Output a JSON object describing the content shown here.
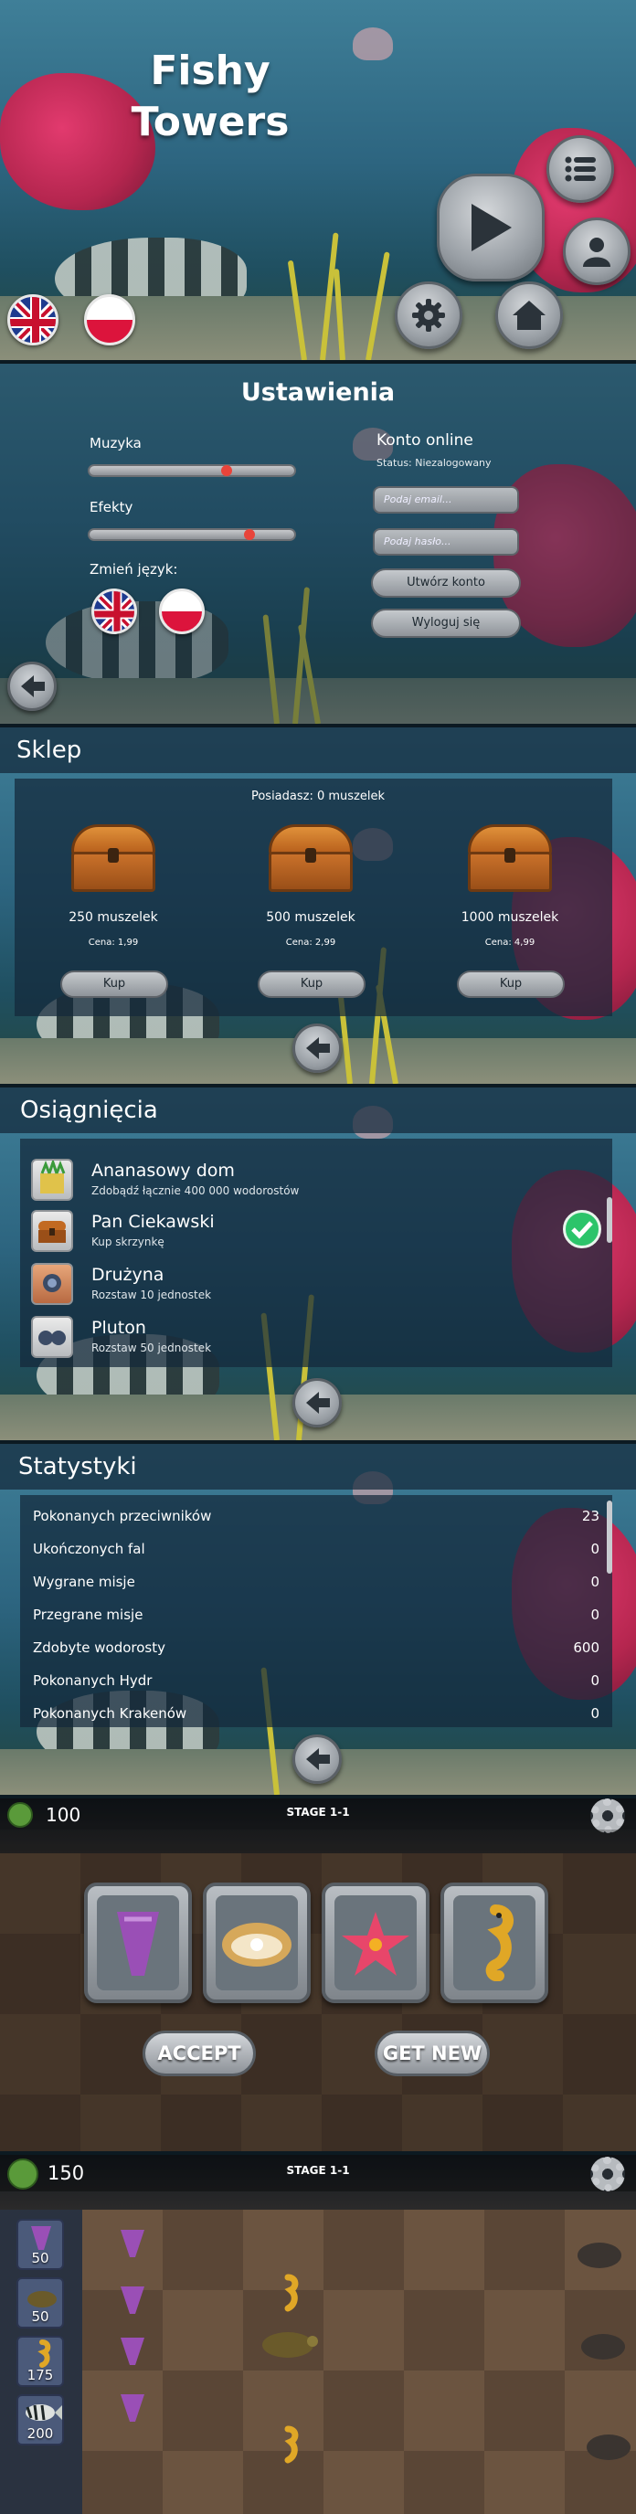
{
  "colors": {
    "coral": "#b5264f",
    "accent_green": "#2cc46a",
    "stone": "#9aa0a6"
  },
  "menu": {
    "title_line1": "Fishy",
    "title_line2": "Towers",
    "icons": [
      "list-icon",
      "play-icon",
      "user-icon",
      "gear-icon",
      "home-icon",
      "flag-uk-icon",
      "flag-pl-icon"
    ]
  },
  "settings": {
    "title": "Ustawienia",
    "music_label": "Muzyka",
    "music_level": 0.67,
    "effects_label": "Efekty",
    "effects_level": 0.78,
    "language_label": "Zmień język:",
    "account_title": "Konto online",
    "status_text": "Status: Niezalogowany",
    "email_placeholder": "Podaj email...",
    "password_placeholder": "Podaj hasło...",
    "create_button": "Utwórz konto",
    "logout_button": "Wyloguj się"
  },
  "shop": {
    "title": "Sklep",
    "owned": "Posiadasz: 0 muszelek",
    "items": [
      {
        "amount": "250 muszelek",
        "price": "Cena: 1,99",
        "buy": "Kup"
      },
      {
        "amount": "500 muszelek",
        "price": "Cena: 2,99",
        "buy": "Kup"
      },
      {
        "amount": "1000 muszelek",
        "price": "Cena: 4,99",
        "buy": "Kup"
      }
    ]
  },
  "achievements": {
    "title": "Osiągnięcia",
    "items": [
      {
        "name": "Ananasowy dom",
        "desc": "Zdobądź łącznie 400 000 wodorostów",
        "done": false
      },
      {
        "name": "Pan Ciekawski",
        "desc": "Kup skrzynkę",
        "done": true
      },
      {
        "name": "Drużyna",
        "desc": "Rozstaw 10 jednostek",
        "done": false
      },
      {
        "name": "Pluton",
        "desc": "Rozstaw 50 jednostek",
        "done": false
      }
    ]
  },
  "stats": {
    "title": "Statystyki",
    "rows": [
      {
        "label": "Pokonanych przeciwników",
        "value": "23"
      },
      {
        "label": "Ukończonych fal",
        "value": "0"
      },
      {
        "label": "Wygrane misje",
        "value": "0"
      },
      {
        "label": "Przegrane misje",
        "value": "0"
      },
      {
        "label": "Zdobyte wodorosty",
        "value": "600"
      },
      {
        "label": "Pokonanych Hydr",
        "value": "0"
      },
      {
        "label": "Pokonanych Krakenów",
        "value": "0"
      }
    ]
  },
  "select": {
    "resource": "100",
    "stage": "STAGE 1-1",
    "accept": "ACCEPT",
    "get_new": "GET NEW",
    "cards": [
      "coral-tower-icon",
      "clam-tower-icon",
      "starfish-tower-icon",
      "seahorse-tower-icon"
    ]
  },
  "battle": {
    "resource": "150",
    "stage": "STAGE 1-1",
    "units": [
      {
        "icon": "coral-unit-icon",
        "cost": "50"
      },
      {
        "icon": "turtle-unit-icon",
        "cost": "50"
      },
      {
        "icon": "seahorse-unit-icon",
        "cost": "175"
      },
      {
        "icon": "fish-unit-icon",
        "cost": "200"
      }
    ]
  }
}
